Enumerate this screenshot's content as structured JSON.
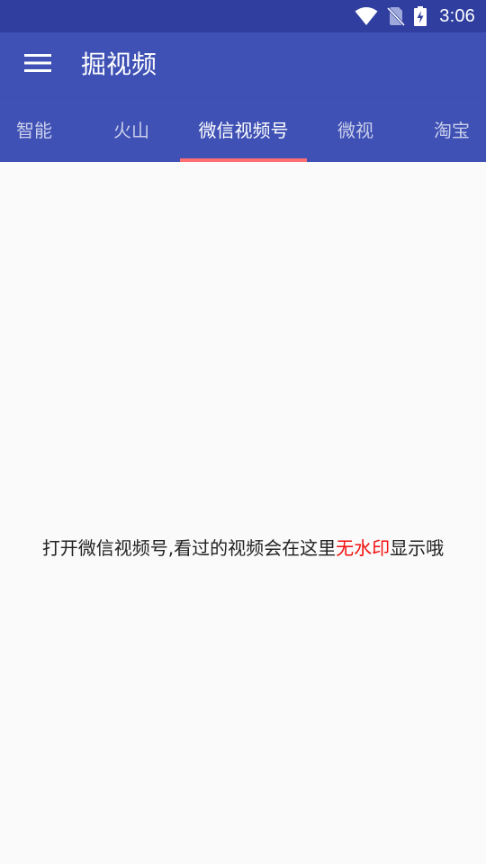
{
  "status_bar": {
    "time": "3:06",
    "icons": [
      "wifi-icon",
      "no-sim-icon",
      "battery-charging-icon"
    ]
  },
  "app_bar": {
    "title": "掘视频",
    "menu_icon": "hamburger-menu-icon"
  },
  "tabs": [
    {
      "label": "智能",
      "active": false
    },
    {
      "label": "火山",
      "active": false
    },
    {
      "label": "微信视频号",
      "active": true
    },
    {
      "label": "微视",
      "active": false
    },
    {
      "label": "淘宝",
      "active": false
    }
  ],
  "message": {
    "prefix": "打开微信视频号,看过的视频会在这里",
    "highlight": "无水印",
    "suffix": "显示哦"
  },
  "colors": {
    "status_bar": "#303f9f",
    "app_bar": "#3f51b5",
    "tab_indicator": "#ff6e72",
    "highlight_text": "#f10f0f",
    "background": "#fafafa"
  }
}
